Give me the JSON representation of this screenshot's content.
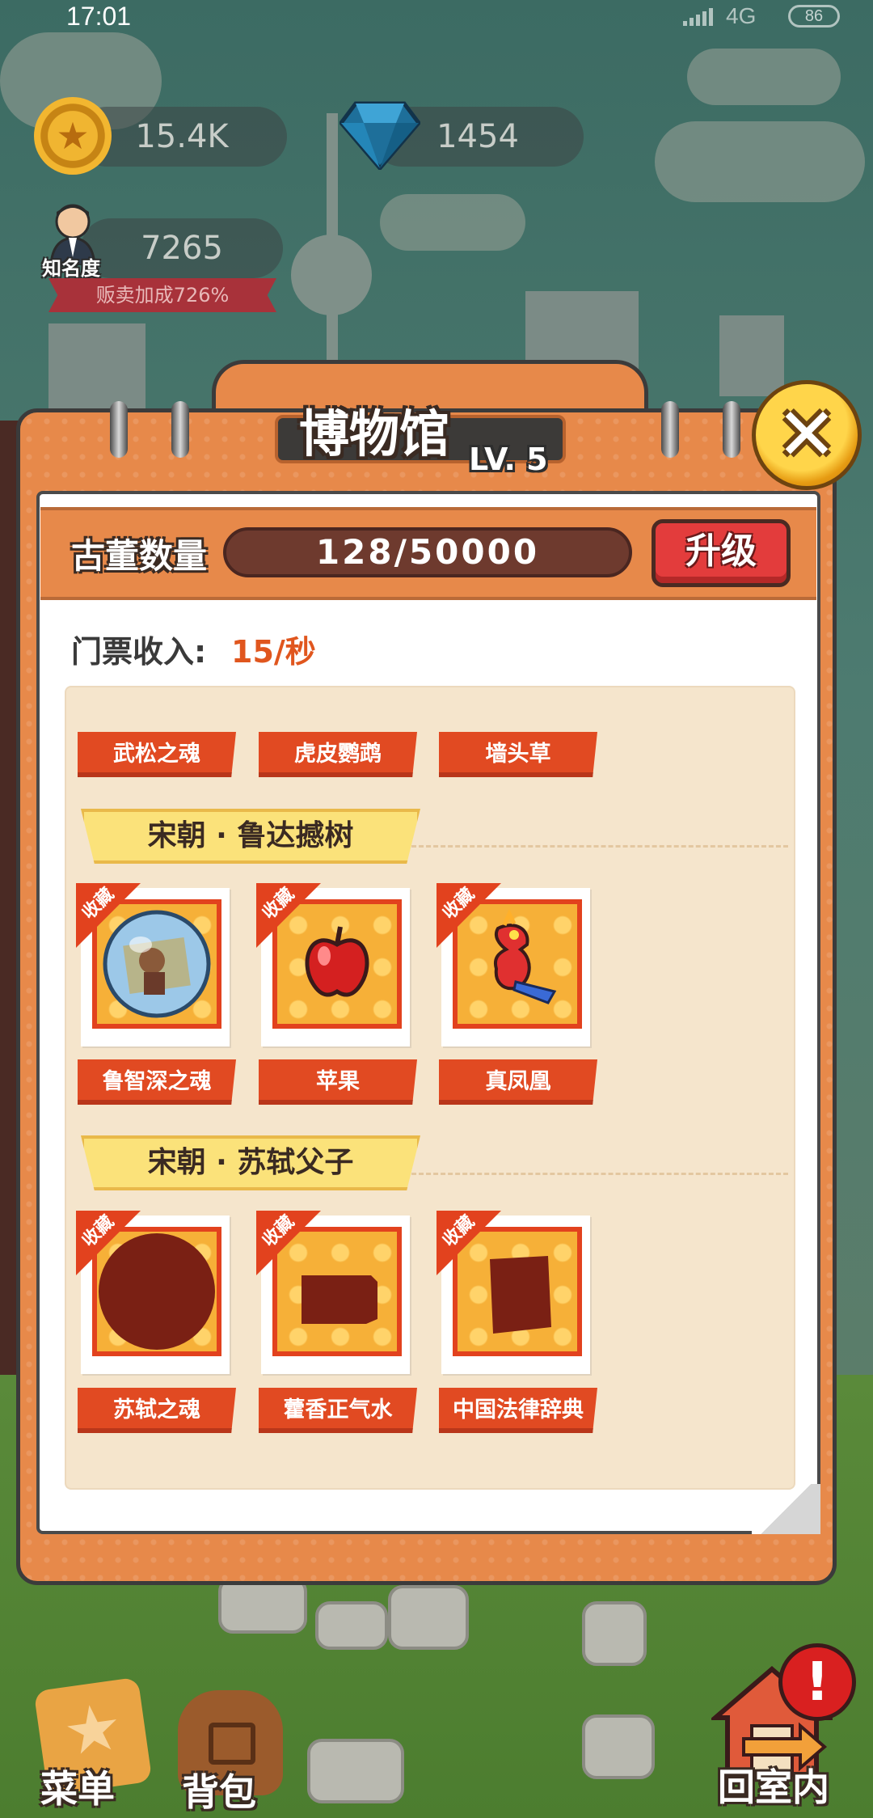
{
  "status_bar": {
    "time": "17:01",
    "network": "4G",
    "battery": "86"
  },
  "hud": {
    "coins": "15.4K",
    "gems": "1454",
    "fame_value": "7265",
    "fame_label": "知名度",
    "bonus": "贩卖加成726%"
  },
  "museum": {
    "title": "博物馆",
    "level": "LV. 5",
    "count_label": "古董数量",
    "count_value": "128/50000",
    "upgrade_label": "升级",
    "ticket_label": "门票收入:",
    "ticket_value": "15/秒",
    "collected_tag": "收藏",
    "top_row": [
      "武松之魂",
      "虎皮鹦鹉",
      "墙头草"
    ],
    "sections": [
      {
        "title": "宋朝 · 鲁达撼树",
        "items": [
          "鲁智深之魂",
          "苹果",
          "真凤凰"
        ]
      },
      {
        "title": "宋朝 · 苏轼父子",
        "items": [
          "苏轼之魂",
          "藿香正气水",
          "中国法律辞典"
        ]
      }
    ]
  },
  "nav": {
    "menu": "菜单",
    "backpack": "背包",
    "back_indoor": "回室内",
    "alert": "!"
  },
  "colors": {
    "panel": "#e7894a",
    "ribbon": "#e14a22",
    "upgrade": "#e33c3c",
    "ticket_value": "#e0561e"
  }
}
